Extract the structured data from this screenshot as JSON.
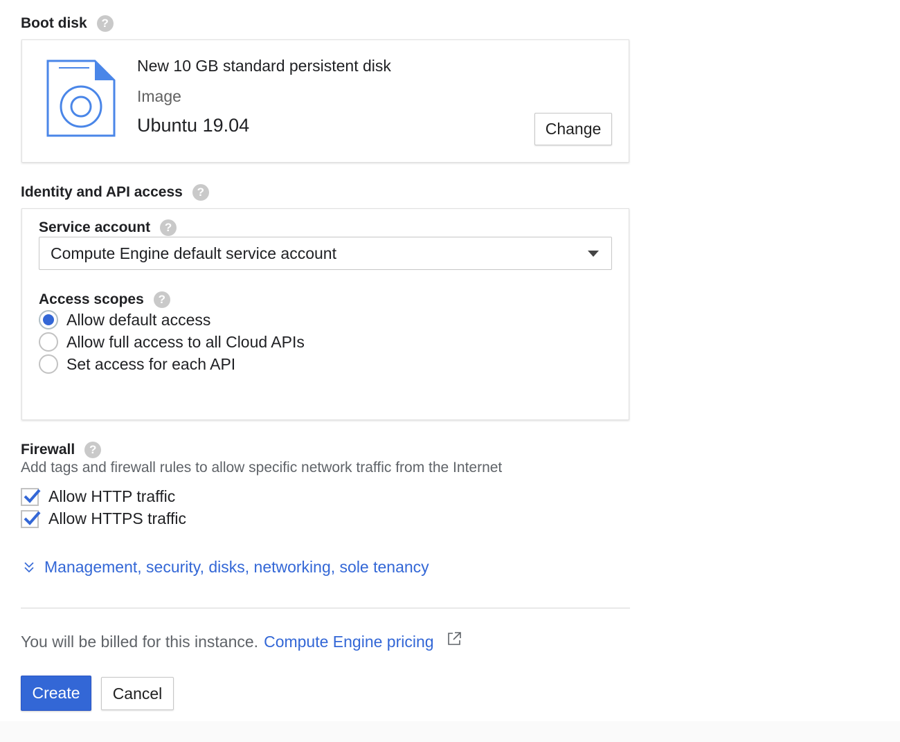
{
  "boot_disk": {
    "title": "Boot disk",
    "help": "?",
    "disk_name": "New 10 GB standard persistent disk",
    "image_label": "Image",
    "image_value": "Ubuntu 19.04",
    "change_label": "Change",
    "icon": "disk-image-icon"
  },
  "identity": {
    "title": "Identity and API access",
    "help": "?",
    "service_account": {
      "label": "Service account",
      "help": "?",
      "selected": "Compute Engine default service account"
    },
    "access_scopes": {
      "label": "Access scopes",
      "help": "?",
      "options": [
        {
          "label": "Allow default access",
          "checked": true
        },
        {
          "label": "Allow full access to all Cloud APIs",
          "checked": false
        },
        {
          "label": "Set access for each API",
          "checked": false
        }
      ]
    }
  },
  "firewall": {
    "title": "Firewall",
    "help": "?",
    "description": "Add tags and firewall rules to allow specific network traffic from the Internet",
    "options": [
      {
        "label": "Allow HTTP traffic",
        "checked": true
      },
      {
        "label": "Allow HTTPS traffic",
        "checked": true
      }
    ]
  },
  "expander": {
    "label": "Management, security, disks, networking, sole tenancy"
  },
  "billing": {
    "text": "You will be billed for this instance.",
    "link": "Compute Engine pricing"
  },
  "actions": {
    "create": "Create",
    "cancel": "Cancel"
  },
  "colors": {
    "accent": "#3367d6",
    "help_icon": "#c9c9c9",
    "disk_icon": "#4a86e8"
  }
}
